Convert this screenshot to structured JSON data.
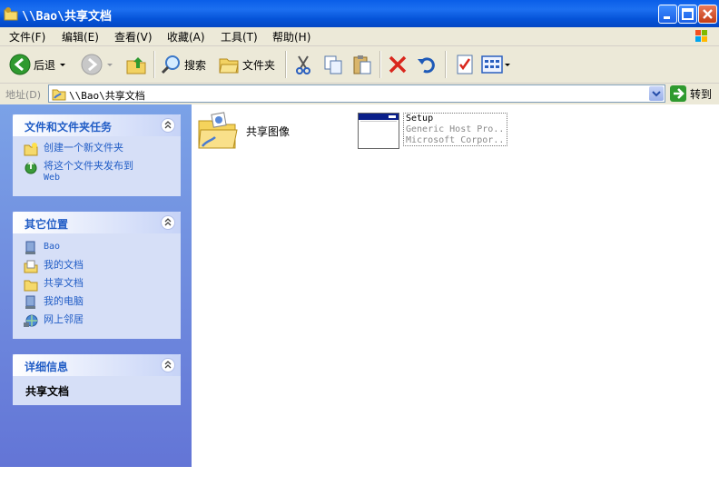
{
  "window": {
    "title": "\\\\Bao\\共享文档"
  },
  "menu": [
    "文件(F)",
    "编辑(E)",
    "查看(V)",
    "收藏(A)",
    "工具(T)",
    "帮助(H)"
  ],
  "toolbar": {
    "back": "后退",
    "search": "搜索",
    "folders": "文件夹"
  },
  "address": {
    "label": "地址(D)",
    "value": "\\\\Bao\\共享文档",
    "go": "转到"
  },
  "tasks_panel": {
    "title": "文件和文件夹任务",
    "items": [
      {
        "label": "创建一个新文件夹",
        "icon": "new-folder-icon"
      },
      {
        "label": "将这个文件夹发布到",
        "label2": "Web",
        "icon": "publish-web-icon"
      }
    ]
  },
  "places_panel": {
    "title": "其它位置",
    "items": [
      {
        "label": "Bao",
        "icon": "computer-share-icon"
      },
      {
        "label": "我的文档",
        "icon": "my-documents-icon"
      },
      {
        "label": "共享文档",
        "icon": "shared-folder-icon"
      },
      {
        "label": "我的电脑",
        "icon": "my-computer-icon"
      },
      {
        "label": "网上邻居",
        "icon": "network-places-icon"
      }
    ]
  },
  "details_panel": {
    "title": "详细信息",
    "name": "共享文档"
  },
  "files": [
    {
      "name": "共享图像",
      "type": "folder",
      "icon": "shared-pictures-folder-icon"
    },
    {
      "name": "Setup",
      "line2": "Generic Host Pro...",
      "line3": "Microsoft Corpor...",
      "icon": "setup-exe-icon"
    }
  ],
  "colors": {
    "titlebar": "#0553d8",
    "panel_link": "#215dc6",
    "left_pane": "#7ba2e7"
  }
}
